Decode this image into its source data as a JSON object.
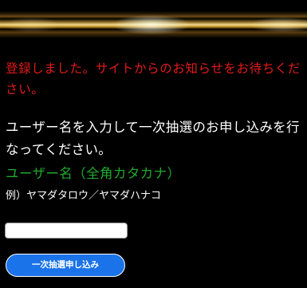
{
  "notice": {
    "message": "登録しました。サイトからのお知らせをお待ちください。"
  },
  "instruction": {
    "text": "ユーザー名を入力して一次抽選のお申し込みを行なってください。"
  },
  "form": {
    "field_label": "ユーザー名（全角カタカナ）",
    "example": "例）ヤマダタロウ／ヤマダハナコ",
    "username_value": "",
    "submit_label": "一次抽選申し込み"
  },
  "colors": {
    "background": "#000000",
    "notice": "#e41b1b",
    "label": "#1faa2b",
    "button": "#1a73e8"
  }
}
